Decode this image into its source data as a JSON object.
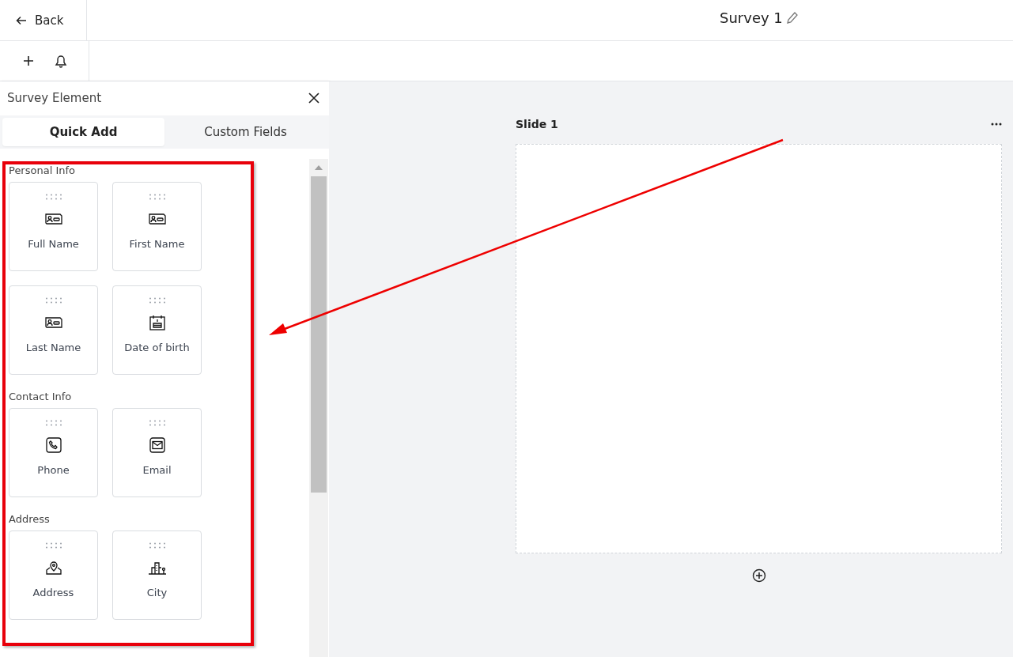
{
  "top_bar": {
    "back": "Back",
    "title": "Survey 1"
  },
  "panel": {
    "title": "Survey Element",
    "tabs": [
      {
        "label": "Quick Add",
        "selected": true
      },
      {
        "label": "Custom Fields",
        "selected": false
      }
    ],
    "groups": [
      {
        "title": "Personal Info",
        "items": [
          {
            "label": "Full Name",
            "kind": "name"
          },
          {
            "label": "First Name",
            "kind": "name"
          },
          {
            "label": "Last Name",
            "kind": "name"
          },
          {
            "label": "Date of birth",
            "kind": "date"
          }
        ]
      },
      {
        "title": "Contact Info",
        "items": [
          {
            "label": "Phone",
            "kind": "phone"
          },
          {
            "label": "Email",
            "kind": "email"
          }
        ]
      },
      {
        "title": "Address",
        "items": [
          {
            "label": "Address",
            "kind": "address"
          },
          {
            "label": "City",
            "kind": "city"
          }
        ]
      }
    ]
  },
  "canvas": {
    "slides": [
      {
        "title": "Slide 1"
      }
    ]
  },
  "annotation": {
    "highlight": true,
    "arrow": true
  }
}
